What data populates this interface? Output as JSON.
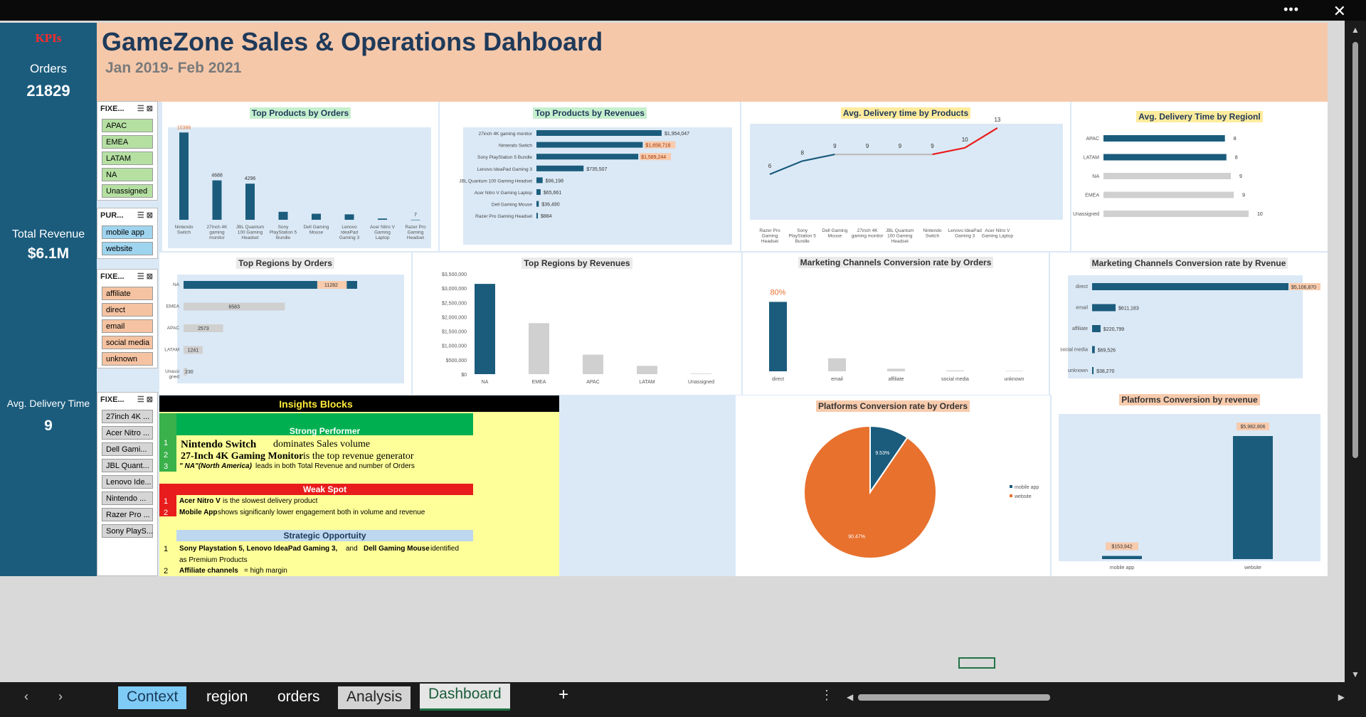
{
  "window": {
    "more_label": "•••",
    "close_label": "✕"
  },
  "kpi": {
    "heading": "KPIs",
    "orders_label": "Orders",
    "orders_value": "21829",
    "revenue_label": "Total Revenue",
    "revenue_value": "$6.1M",
    "delivery_label": "Avg. Delivery Time",
    "delivery_value": "9"
  },
  "header": {
    "title": "GameZone Sales & Operations Dahboard",
    "subtitle": "Jan 2019- Feb 2021"
  },
  "slicers": [
    {
      "title": "FIXE...",
      "items": [
        "APAC",
        "EMEA",
        "LATAM",
        "NA",
        "Unassigned"
      ]
    },
    {
      "title": "PUR...",
      "items": [
        "mobile app",
        "website"
      ]
    },
    {
      "title": "FIXE...",
      "items": [
        "affiliate",
        "direct",
        "email",
        "social media",
        "unknown"
      ]
    },
    {
      "title": "FIXE...",
      "items": [
        "27inch 4K ...",
        "Acer Nitro ...",
        "Dell Gami...",
        "JBL Quant...",
        "Lenovo Ide...",
        "Nintendo ...",
        "Razer Pro ...",
        "Sony PlayS..."
      ]
    }
  ],
  "chart_data": [
    {
      "id": "top-products-orders",
      "type": "bar",
      "title": "Top Products by Orders",
      "categories": [
        [
          "Nintendo",
          "Switch"
        ],
        [
          "27inch 4K",
          "gaming",
          "monitor"
        ],
        [
          "JBL Quantum",
          "100 Gaming",
          "Headset"
        ],
        [
          "Sony",
          "PlayStation 5",
          "Bundle"
        ],
        [
          "Dell Gaming",
          "Mouse"
        ],
        [
          "Lenovo",
          "IdeaPad",
          "Gaming 3"
        ],
        [
          "Acer Nitro V",
          "Gaming",
          "Laptop"
        ],
        [
          "Razer Pro",
          "Gaming",
          "Headset"
        ]
      ],
      "values": [
        10386,
        4688,
        4296,
        950,
        720,
        650,
        150,
        7
      ],
      "labels": [
        "10386",
        "4688",
        "4296",
        "",
        "",
        "",
        "",
        "7"
      ],
      "ylim": [
        0,
        11000
      ]
    },
    {
      "id": "top-products-revenue",
      "type": "bar",
      "orientation": "horizontal",
      "title": "Top Products by Revenues",
      "categories": [
        "27inch 4K gaming monitor",
        "Nintendo Switch",
        "Sony PlayStation 5 Bundle",
        "Lenovo IdeaPad Gaming 3",
        "JBL Quantum 100 Gaming Headset",
        "Acer Nitro V Gaming Laptop",
        "Dell Gaming Mouse",
        "Razer Pro Gaming Headset"
      ],
      "values": [
        1954047,
        1658718,
        1589244,
        735507,
        96198,
        65661,
        36490,
        884
      ],
      "labels": [
        "$1,954,047",
        "$1,658,718",
        "$1,589,244",
        "$735,507",
        "$96,198",
        "$65,661",
        "$36,490",
        "$884"
      ]
    },
    {
      "id": "delivery-by-product",
      "type": "line",
      "title": "Avg. Delivery time by Products",
      "categories": [
        [
          "Razer Pro",
          "Gaming",
          "Headset"
        ],
        [
          "Sony",
          "PlayStation 5",
          "Bundle"
        ],
        [
          "Dell Gaming",
          "Mouse"
        ],
        [
          "27inch 4K",
          "gaming monitor"
        ],
        [
          "JBL Quantum",
          "100 Gaming",
          "Headset"
        ],
        [
          "Nintendo",
          "Switch"
        ],
        [
          "Lenovo IdeaPad",
          "Gaming 3"
        ],
        [
          "Acer Nitro V",
          "Gaming Laptop"
        ]
      ],
      "values": [
        6,
        8,
        9,
        9,
        9,
        9,
        10,
        13
      ]
    },
    {
      "id": "delivery-by-region",
      "type": "bar",
      "orientation": "horizontal",
      "title": "Avg. Delivery Time by Regionl",
      "categories": [
        "APAC",
        "LATAM",
        "NA",
        "EMEA",
        "Unassigned"
      ],
      "values": [
        8.2,
        8.3,
        8.6,
        8.8,
        9.8
      ],
      "labels": [
        "8",
        "8",
        "9",
        "9",
        "10"
      ]
    },
    {
      "id": "regions-orders",
      "type": "bar",
      "orientation": "horizontal",
      "title": "Top Regions by Orders",
      "categories": [
        "NA",
        "EMEA",
        "APAC",
        "LATAM",
        [
          "Unassi",
          "gned"
        ]
      ],
      "values": [
        11282,
        6583,
        2573,
        1241,
        230
      ],
      "labels": [
        "11282",
        "6583",
        "2573",
        "1241",
        "230"
      ]
    },
    {
      "id": "regions-revenue",
      "type": "bar",
      "title": "Top Regions by Revenues",
      "categories": [
        "NA",
        "EMEA",
        "APAC",
        "LATAM",
        "Unassigned"
      ],
      "values": [
        3150000,
        1780000,
        680000,
        290000,
        20000
      ],
      "yticks": [
        "$0",
        "$500,000",
        "$1,000,000",
        "$1,500,000",
        "$2,000,000",
        "$2,500,000",
        "$3,000,000",
        "$3,500,000"
      ],
      "ylim": [
        0,
        3500000
      ]
    },
    {
      "id": "channels-orders",
      "type": "bar",
      "title": "Marketing Channels Conversion rate by Orders",
      "categories": [
        "direct",
        "email",
        "affiliate",
        "social media",
        "unknown"
      ],
      "values": [
        80,
        15,
        3,
        1,
        0.5
      ],
      "labels": [
        "80%",
        "",
        "",
        "",
        ""
      ],
      "ylim": [
        0,
        100
      ]
    },
    {
      "id": "channels-revenue",
      "type": "bar",
      "orientation": "horizontal",
      "title": "Marketing Channels Conversion rate by Rvenue",
      "categories": [
        "direct",
        "email",
        "affiliate",
        "social media",
        "unknown"
      ],
      "values": [
        5106870,
        611183,
        220799,
        69526,
        38270
      ],
      "labels": [
        "$5,106,870",
        "$611,183",
        "$220,799",
        "$69,526",
        "$38,270"
      ]
    },
    {
      "id": "platforms-orders",
      "type": "pie",
      "title": "Platforms Conversion rate by Orders",
      "series": [
        {
          "name": "mobile app",
          "value": 9.53,
          "label": "9.53%"
        },
        {
          "name": "website",
          "value": 90.47,
          "label": "90.47%"
        }
      ]
    },
    {
      "id": "platforms-revenue",
      "type": "bar",
      "title": "Platforms Conversion by revenue",
      "categories": [
        "mobile app",
        "website"
      ],
      "values": [
        153942,
        5982806
      ],
      "labels": [
        "$153,942",
        "$5,982,806"
      ]
    }
  ],
  "insights": {
    "title": "Insights Blocks",
    "strong": {
      "title": "Strong Performer",
      "rows": [
        {
          "n": "1",
          "b": "Nintendo Switch",
          "t": " dominates Sales volume"
        },
        {
          "n": "2",
          "b": "27-Inch 4K Gaming Monitor",
          "t": " is the top revenue generator"
        },
        {
          "n": "3",
          "b": "\" NA\"(North America)",
          "t": "  leads in both Total Revenue and number of Orders"
        }
      ]
    },
    "weak": {
      "title": "Weak Spot",
      "rows": [
        {
          "n": "1",
          "b": "Acer Nitro V",
          "t": " is the slowest delivery product"
        },
        {
          "n": "2",
          "b": "Mobile App",
          "t": " shows significanly lower engagement both in volume and revenue"
        }
      ]
    },
    "strategic": {
      "title": "Strategic Opportuity",
      "rows": [
        {
          "n": "1",
          "b": "Sony Playstation 5, Lenovo IdeaPad Gaming 3,",
          "t": " and ",
          "b2": "Dell Gaming Mouse",
          "t2": " identified"
        },
        {
          "n": "",
          "b": "",
          "t": "as Premium Products"
        },
        {
          "n": "2",
          "b": "Affiliate channels",
          "t": " = high margin"
        }
      ]
    }
  },
  "tabs": [
    "Context",
    "region",
    "orders",
    "Analysis",
    "Dashboard"
  ],
  "colors": {
    "navy": "#1b5c7d",
    "gray": "#d0d0d0",
    "orange": "#e8712e",
    "red": "#e81c1c",
    "peach": "#f5c8aa"
  }
}
